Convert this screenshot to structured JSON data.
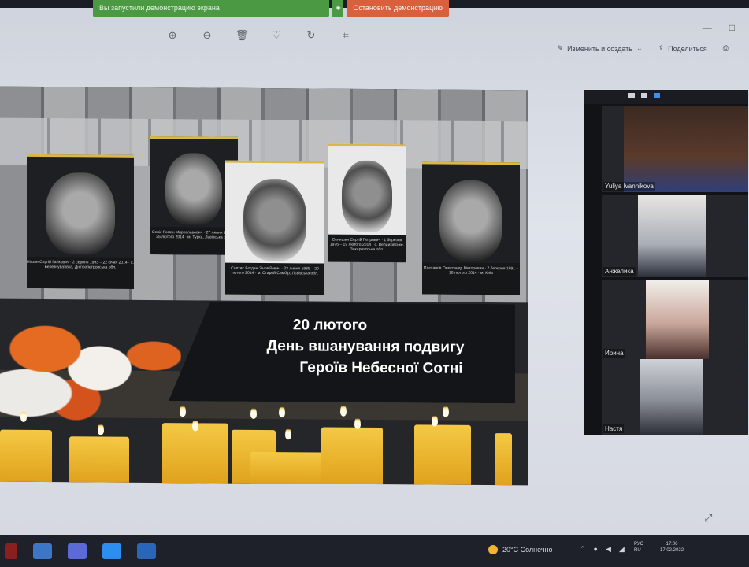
{
  "share_bar": {
    "status": "Вы запустили демонстрацию экрана",
    "stop": "Остановить демонстрацию"
  },
  "window": {
    "minimize": "—",
    "maximize": "□"
  },
  "viewer": {
    "tools": [
      {
        "name": "zoom-in-icon",
        "glyph": "⊕"
      },
      {
        "name": "zoom-out-icon",
        "glyph": "⊖"
      },
      {
        "name": "delete-icon",
        "glyph": "🗑"
      },
      {
        "name": "favorite-icon",
        "glyph": "♡"
      },
      {
        "name": "rotate-icon",
        "glyph": "↻"
      },
      {
        "name": "crop-icon",
        "glyph": "⌗"
      }
    ],
    "edit_create": "Изменить и создать",
    "share": "Поделиться"
  },
  "slide": {
    "line1": "20 лютого",
    "line2": "День вшанування подвигу",
    "line3": "Героїв Небесної Сотні",
    "plates": [
      "Нігоян Сергій Гагікович · 2 серпня 1993 – 22 січня 2014 · с. Березнуватівка, Дніпропетровська обл.",
      "Сенік Роман Мирославович · 27 липня 1969 – 25 лютого 2014 · м. Турка, Львівська обл.",
      "Солтис Богдан Зіновійович · 23 липня 1985 – 20 лютого 2014 · м. Старий Самбір, Львівська обл.",
      "Сенишин Сергій Петрович · 1 березня 1976 – 19 лютого 2014 · с. Велдихівське, Закарпатська обл.",
      "Плеханов Олександр Вікторович · 7 березня 1991 – 18 лютого 2014 · м. Київ"
    ]
  },
  "participants": [
    {
      "name": "Yuliya Ivannikova"
    },
    {
      "name": "Анжелика"
    },
    {
      "name": "Ирина"
    },
    {
      "name": "Настя"
    }
  ],
  "taskbar": {
    "weather": "20°C Солнечно",
    "lang": "РУС",
    "lang2": "RU",
    "time": "17:06",
    "date": "17.02.2022"
  },
  "colors": {
    "share_green": "#4b9a43",
    "stop_red": "#d9603c",
    "active_tab": "#3e8ff0"
  }
}
